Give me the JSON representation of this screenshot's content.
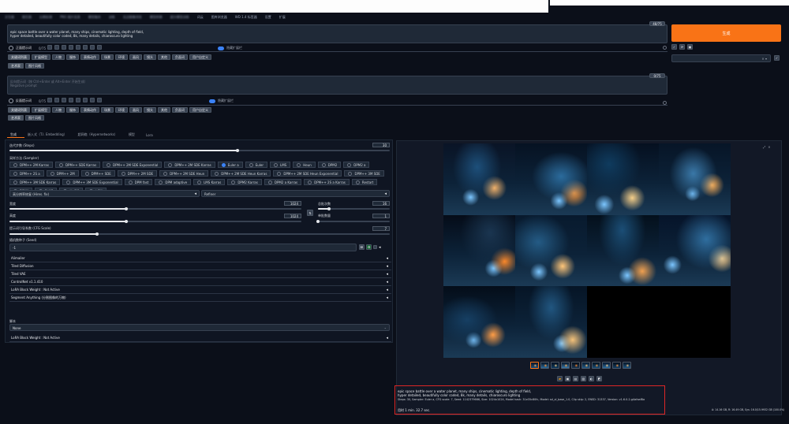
{
  "top_tabs": [
    "文生图",
    "图生图",
    "后期处理",
    "PNG 图片信息",
    "模型融合",
    "训练",
    "无边图像浏览",
    "模型转换",
    "超分模型训练",
    "词云",
    "图库浏览器",
    "WD 1.4 标签器",
    "设置",
    "扩展"
  ],
  "prompt": {
    "counter": "48/75",
    "text_line1": "epic space battle over a water planet, many ships, cinematic lighting, depth of field,",
    "text_line2": "hyper detailed, beautifully color coded, 8k, many details, chiaroscuro lighting"
  },
  "positive_section": {
    "title": "正面提示词",
    "count": "0/75",
    "toggle_label": "隐藏扩展栏",
    "tabs": [
      "关键词列表",
      "扩展模型",
      "人物",
      "服饰",
      "表情动作",
      "场景",
      "环境",
      "画风",
      "镜头",
      "其他",
      "负面词",
      "用户自定义"
    ],
    "sub_tabs": [
      "艺术家",
      "图片风格"
    ]
  },
  "negative_prompt": {
    "counter": "0/75",
    "placeholder_line1": "反向提示词（按 Ctrl+Enter 或 Alt+Enter 开始生成）",
    "placeholder_line2": "Negative prompt"
  },
  "negative_section": {
    "title": "反面提示词",
    "count": "0/75",
    "toggle_label": "隐藏扩展栏",
    "tabs": [
      "关键词列表",
      "扩展模型",
      "人物",
      "服饰",
      "表情动作",
      "场景",
      "环境",
      "画风",
      "镜头",
      "其他",
      "负面词",
      "用户自定义"
    ],
    "sub_tabs": [
      "艺术家",
      "图片风格"
    ]
  },
  "generate_button": "生成",
  "styles_dropdown": {
    "value": ""
  },
  "sub_tabs": [
    "生成",
    "嵌入式（T.I. Embedding）",
    "超网络（Hypernetworks）",
    "模型",
    "Lora"
  ],
  "sampling_steps": {
    "label": "迭代步数 (Steps)",
    "value": "30",
    "fraction": 0.6
  },
  "sampler": {
    "label": "采样方法 (Sampler)",
    "options": [
      "DPM++ 2M Karras",
      "DPM++ SDE Karras",
      "DPM++ 2M SDE Exponential",
      "DPM++ 2M SDE Karras",
      "Euler a",
      "Euler",
      "LMS",
      "Heun",
      "DPM2",
      "DPM2 a",
      "DPM++ 2S a",
      "DPM++ 2M",
      "DPM++ SDE",
      "DPM++ 2M SDE",
      "DPM++ 2M SDE Heun",
      "DPM++ 2M SDE Heun Karras",
      "DPM++ 2M SDE Heun Exponential",
      "DPM++ 3M SDE",
      "DPM++ 3M SDE Karras",
      "DPM++ 3M SDE Exponential",
      "DPM fast",
      "DPM adaptive",
      "LMS Karras",
      "DPM2 Karras",
      "DPM2 a Karras",
      "DPM++ 2S a Karras",
      "Restart",
      "DDIM",
      "PLMS",
      "UniPC",
      "LCM"
    ],
    "selected": "Euler a"
  },
  "hires_fix": {
    "label": "高分辨率修复 (Hires. fix)",
    "refiner_label": "Refiner"
  },
  "width": {
    "label": "宽度",
    "value": "1024",
    "fraction": 0.4
  },
  "height": {
    "label": "高度",
    "value": "1024",
    "fraction": 0.4
  },
  "batch_count": {
    "label": "总批次数",
    "value": "16",
    "fraction": 0.15
  },
  "batch_size": {
    "label": "单批数量",
    "value": "1",
    "fraction": 0.0
  },
  "cfg_scale": {
    "label": "提示词引导系数 (CFG Scale)",
    "value": "7",
    "fraction": 0.23
  },
  "seed": {
    "label": "随机数种子 (Seed)",
    "value": "-1"
  },
  "accordions": [
    "Alimailer",
    "Tiled Diffusion",
    "Tiled VAE",
    "ControlNet v1.1.410",
    "LoRA Block Weight : Not Active",
    "Segment Anything (分割图像的万物)"
  ],
  "script": {
    "label": "脚本",
    "value": "None"
  },
  "last_accordion": "LoRA Block Weight : Not Active",
  "gallery_controls": {
    "expand": "⤢",
    "close": "×"
  },
  "info": {
    "line1": "epic space battle over a water planet, many ships, cinematic lighting, depth of field,",
    "line2": "hyper detailed, beautifully color coded, 8k, many details, chiaroscuro lighting",
    "line3": "Steps: 30, Sampler: Euler a, CFG scale: 7, Seed: 1142379666, Size: 1024x1024, Model hash: 31e35c80fc, Model: sd_xl_base_1.0, Clip skip: 2, ENSD: 31337, Version: v1.6.0-2-g4afaaf8a",
    "line4": "用时 1 min. 32.7 sec.",
    "vram": "A: 14.16 GB, R: 16.49 GB, Sys: 16.0/15.9932 GB (100.0%)"
  },
  "colors": {
    "accent": "#f97316",
    "background": "#0b0f19",
    "panel": "#1f2937",
    "highlight_box": "#dc2626"
  }
}
